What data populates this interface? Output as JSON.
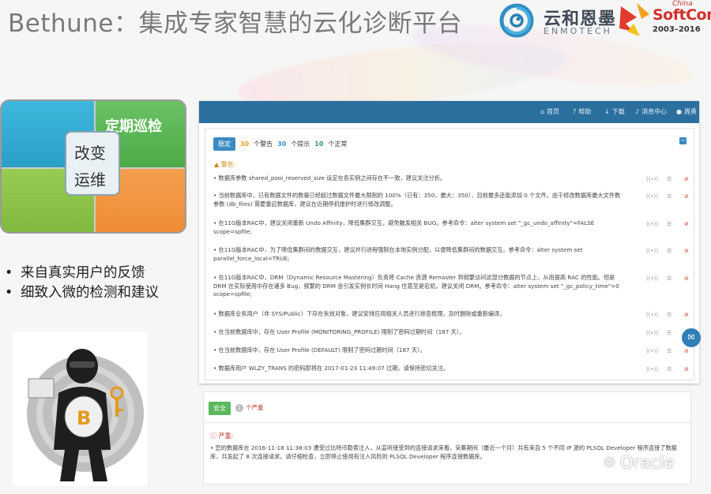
{
  "slide": {
    "title": "Bethune：集成专家智慧的云化诊断平台",
    "brand_cn": "云和恩墨",
    "brand_en": "ENMOTECH",
    "softcon": {
      "china": "China",
      "name": "SoftCon",
      "years": "2003–2016"
    }
  },
  "quad": {
    "top_right_label": "定期巡检",
    "center_line1": "改变",
    "center_line2": "运维"
  },
  "bullets": [
    "来自真实用户的反馈",
    "细致入微的检测和建议"
  ],
  "nav": {
    "home": "首页",
    "help": "帮助",
    "download": "下载",
    "messages": "消息中心",
    "user": "周勇"
  },
  "summary": {
    "status_button": "稳定",
    "warn_count": "30",
    "warn_label": "个警告",
    "hint_count": "30",
    "hint_label": "个提示",
    "normal_count": "10",
    "normal_label": "个正常",
    "colors": {
      "warn": "#e8a22b",
      "hint": "#3d8bc2",
      "normal": "#2e9e5a"
    }
  },
  "warnings": {
    "heading": "警告:",
    "rows": [
      {
        "text": "• 数据库参数 shared_pool_reserved_size 设定在各实例之间存在不一致，建议关注分析。"
      },
      {
        "text": "• 当前数据库中，已有数据文件的数量已经超过数据文件最大限制的 100%（已有：350，最大：350），目前最多还能添加 0 个文件。由于修改数据库最大文件数参数 (db_files) 需要重启数据库，建议在近期停机维护时进行修改调整。"
      },
      {
        "text": "• 在11G版本RAC中，建议关闭重新 Undo Affinity，降低集群交互，避免触发相关 BUG。参考命令：alter system set \"_gc_undo_affinity\"=FALSE scope=spfile;"
      },
      {
        "text": "• 在11G版本RAC中，为了降低集群间的数据交互，建议并行进程强制在本地实例分配，以便降低集群间的数据交互。参考命令：alter system set parallel_force_local=TRUE;"
      },
      {
        "text": "• 在11G版本RAC中，DRM（Dynamic Resource Mastering）负责将 Cache 资源 Remaster 到频繁访问这部分数据的节点上，从而提高 RAC 的性能。但是 DRM 在实际使用中存在诸多 Bug，频繁的 DRM 会引发实例长时间 Hang 住甚至是宕机，建议关闭 DRM。参考命令：alter system set \"_gc_policy_time\"=0 scope=spfile;"
      },
      {
        "text": "• 数据库业务用户（非 SYS/Public）下存在失效对象，建议安排应用相关人员进行排查梳理，及时删除或重新编译。"
      },
      {
        "text": "• 在当前数据库中，存在 User Profile (MONITORING_PROFILE) 限制了密码过期时间（187 天）。"
      },
      {
        "text": "• 在当前数据库中，存在 User Profile (DEFAULT) 限制了密码过期时间（187 天）。"
      },
      {
        "text": "• 数据库用户 WLZY_TRANS 的密码即将在 2017-01-23 11:49:07 过期，请保持密切关注。"
      }
    ]
  },
  "security": {
    "tab": "安全",
    "count": "1",
    "count_label": "个严重",
    "heading": "严重:",
    "row": "• 您的数据库在 2016-11-18 11:38:03 遭受过比特币勒索注入，从监听接受到的连接请求来看，采集期间（最近一个月）共有来自 5 个不同 IP 源的 PLSQL Developer 程序连接了数据库，共发起了 8 次连接请求。请仔细检查，立即停止使用有注入风险的 PLSQL Developer 程序连接数据库。"
  },
  "watermark": "Oracle"
}
